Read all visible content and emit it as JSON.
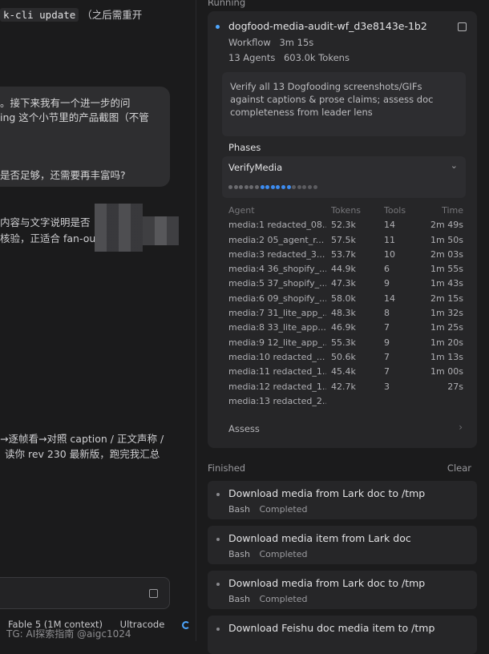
{
  "chat": {
    "line1_code": "k-cli update",
    "line1_text": "（之后需重开",
    "bubble_lines": [
      "。接下来我有一个进一步的问",
      "ing 这个小节里的产品截图（不管",
      "是否足够，还需要再丰富吗?"
    ],
    "reply1_lines": [
      "内容与文字说明是否",
      "核验，正适合 fan-ou"
    ],
    "reply2_lines": [
      "→逐帧看→对照 caption / 正文声称 /",
      "读你 rev 230 最新版，跑完我汇总"
    ],
    "footer": {
      "model": "Fable 5 (1M context)",
      "mode": "Ultracode"
    },
    "watermark": "TG: AI探索指南 @aigc1024"
  },
  "running": {
    "label": "Running",
    "workflow": {
      "title": "dogfood-media-audit-wf_d3e8143e-1b2",
      "label_workflow": "Workflow",
      "duration": "3m 15s",
      "agents": "13 Agents",
      "tokens": "603.0k Tokens",
      "task": "Verify all 13 Dogfooding screenshots/GIFs against captions & prose claims; assess doc completeness from leader lens",
      "phases_label": "Phases",
      "phase_name": "VerifyMedia",
      "progress": {
        "done": 6,
        "active": 6,
        "total": 17
      },
      "table": {
        "headers": [
          "Agent",
          "Tokens",
          "Tools",
          "Time"
        ],
        "rows": [
          [
            "media:1 redacted_08...",
            "52.3k",
            "14",
            "2m 49s"
          ],
          [
            "media:2 05_agent_r...",
            "57.5k",
            "11",
            "1m 50s"
          ],
          [
            "media:3 redacted_3...",
            "53.7k",
            "10",
            "2m 03s"
          ],
          [
            "media:4 36_shopify_...",
            "44.9k",
            "6",
            "1m 55s"
          ],
          [
            "media:5 37_shopify_...",
            "47.3k",
            "9",
            "1m 43s"
          ],
          [
            "media:6 09_shopify_...",
            "58.0k",
            "14",
            "2m 15s"
          ],
          [
            "media:7 31_lite_app_...",
            "48.3k",
            "8",
            "1m 32s"
          ],
          [
            "media:8 33_lite_app...",
            "46.9k",
            "7",
            "1m 25s"
          ],
          [
            "media:9 12_lite_app_...",
            "55.3k",
            "9",
            "1m 20s"
          ],
          [
            "media:10 redacted_...",
            "50.6k",
            "7",
            "1m 13s"
          ],
          [
            "media:11 redacted_1...",
            "45.4k",
            "7",
            "1m 00s"
          ],
          [
            "media:12 redacted_1...",
            "42.7k",
            "3",
            "27s"
          ],
          [
            "media:13 redacted_2...",
            "",
            "",
            ""
          ]
        ]
      },
      "next_phase": "Assess"
    }
  },
  "finished": {
    "label": "Finished",
    "clear": "Clear",
    "items": [
      {
        "title": "Download media from Lark doc to /tmp",
        "tool": "Bash",
        "status": "Completed"
      },
      {
        "title": "Download media item from Lark doc",
        "tool": "Bash",
        "status": "Completed"
      },
      {
        "title": "Download media from Lark doc to /tmp",
        "tool": "Bash",
        "status": "Completed"
      },
      {
        "title": "Download Feishu doc media item to /tmp",
        "tool": "",
        "status": ""
      }
    ]
  },
  "colors": {
    "accent": "#4ea7ff",
    "panel": "#262628",
    "background": "#1b1b1c"
  }
}
